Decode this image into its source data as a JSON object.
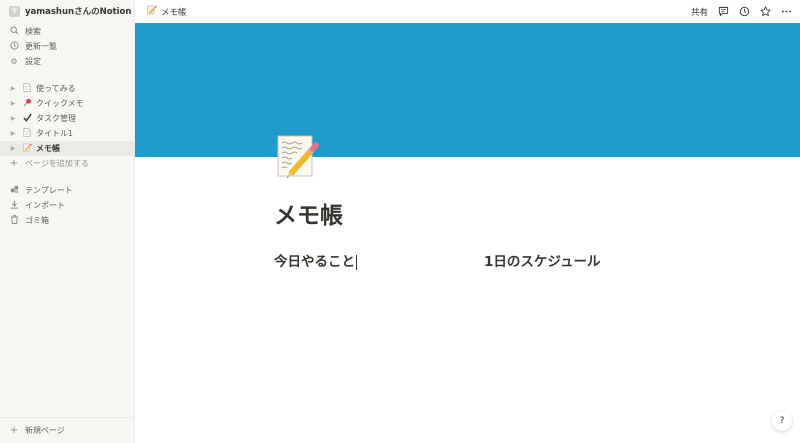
{
  "workspace": {
    "avatar_letter": "Y",
    "name": "yamashunさんのNotion"
  },
  "nav": [
    {
      "label": "検索",
      "icon": "search-icon"
    },
    {
      "label": "更新一覧",
      "icon": "clock-icon"
    },
    {
      "label": "設定",
      "icon": "gear-icon"
    }
  ],
  "pages": [
    {
      "label": "使ってみる",
      "icon": "document-icon"
    },
    {
      "label": "クイックメモ",
      "icon": "pushpin-icon"
    },
    {
      "label": "タスク管理",
      "icon": "checkmark-icon"
    },
    {
      "label": "タイトル1",
      "icon": "document-icon"
    },
    {
      "label": "メモ帳",
      "icon": "memo-icon",
      "active": true
    }
  ],
  "add_page_label": "ページを追加する",
  "tools": [
    {
      "label": "テンプレート",
      "icon": "template-icon"
    },
    {
      "label": "インポート",
      "icon": "download-icon"
    },
    {
      "label": "ゴミ箱",
      "icon": "trash-icon"
    }
  ],
  "new_page_label": "新規ページ",
  "topbar": {
    "breadcrumb": "メモ帳",
    "share_label": "共有"
  },
  "page": {
    "title": "メモ帳",
    "column1_heading": "今日やること",
    "column2_heading": "1日のスケジュール",
    "cover_color": "#1e9bcb"
  },
  "help_label": "?"
}
